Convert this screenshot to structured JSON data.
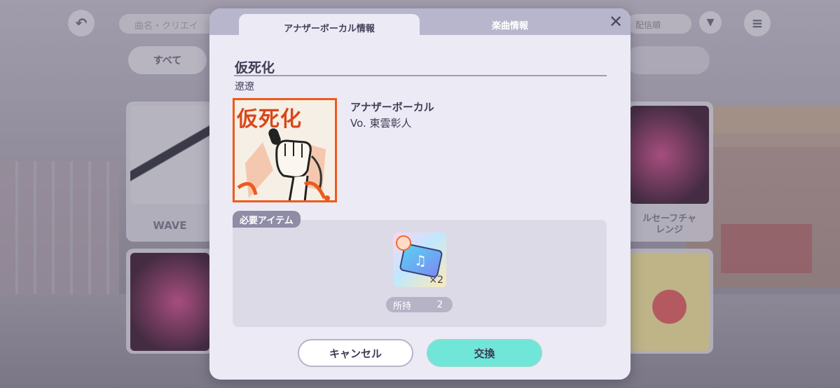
{
  "background": {
    "search_placeholder": "曲名・クリエイ",
    "sort_label": "配信順",
    "filter_all_label": "すべて",
    "cards": [
      {
        "label": "WAVE"
      },
      {
        "label": "ルセーフチャ\nレンジ"
      }
    ]
  },
  "modal": {
    "tabs": [
      {
        "label": "アナザーボーカル情報",
        "active": true
      },
      {
        "label": "楽曲情報",
        "active": false
      }
    ],
    "close_icon": "close-icon"
  },
  "song": {
    "title": "仮死化",
    "creator": "遼遼",
    "jacket_text": "仮死化"
  },
  "vocal": {
    "type_label": "アナザーボーカル",
    "singer": "Vo. 東雲彰人"
  },
  "required_items": {
    "label": "必要アイテム",
    "item_quantity": "×2",
    "owned_label": "所持",
    "owned_count": "2"
  },
  "buttons": {
    "cancel": "キャンセル",
    "exchange": "交換"
  },
  "colors": {
    "accent_exchange": "#6fe6d8",
    "jacket_border": "#ec5a1c",
    "tab_bar": "#b8b6cc"
  }
}
